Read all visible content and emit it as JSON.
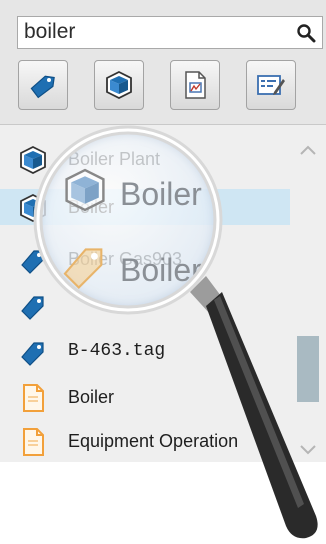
{
  "search": {
    "value": "boiler"
  },
  "toolbar": {
    "buttons": [
      {
        "name": "tag-filter-button",
        "icon": "tag-icon"
      },
      {
        "name": "object-filter-button",
        "icon": "cube-icon"
      },
      {
        "name": "document-filter-button",
        "icon": "document-icon"
      },
      {
        "name": "form-filter-button",
        "icon": "form-edit-icon"
      }
    ]
  },
  "results": [
    {
      "label": "Boiler Plant",
      "icon": "cube-icon"
    },
    {
      "label": "Boiler",
      "icon": "cube-icon"
    },
    {
      "label": "Boiler Gas903",
      "icon": "tag-icon"
    },
    {
      "label": "",
      "icon": "tag-icon"
    },
    {
      "label": "B-463.tag",
      "icon": "tag-icon"
    },
    {
      "label": "Boiler",
      "icon": "document-icon"
    },
    {
      "label": "Equipment Operation",
      "icon": "document-icon"
    }
  ],
  "magnifier": {
    "line1": "Boiler",
    "line2": "Boiler"
  },
  "colors": {
    "accent": "#1f6fb2",
    "selection": "#cfe6f3",
    "document": "#f2a03a"
  }
}
